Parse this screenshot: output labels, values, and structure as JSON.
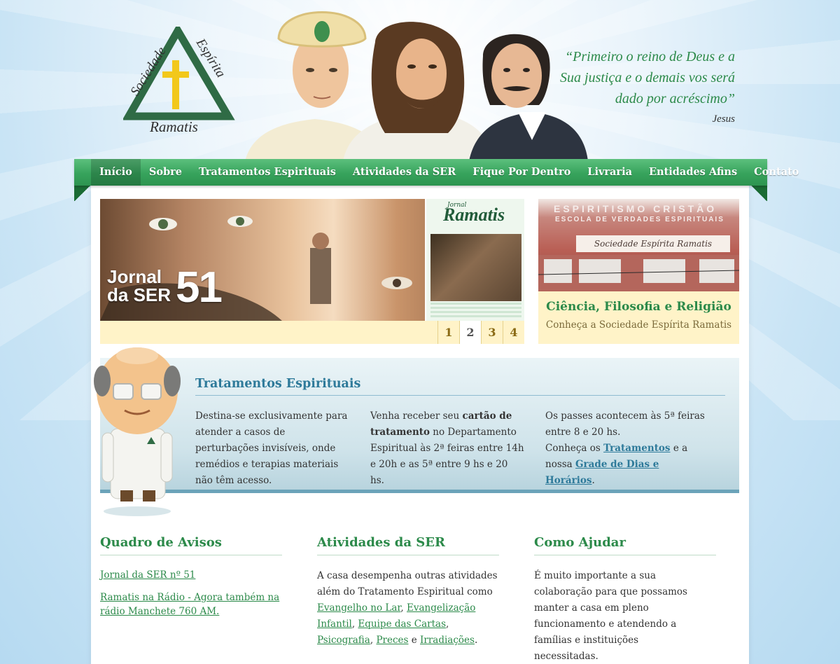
{
  "logo": {
    "line1": "Sociedade",
    "line2": "Espírita",
    "line3": "Ramatis",
    "colors": {
      "triangle": "#2f6b45",
      "cross": "#f2c81a"
    }
  },
  "quote": {
    "text": "“Primeiro o reino de Deus e a Sua justiça e o demais vos será dado por acréscimo”",
    "author": "Jesus"
  },
  "nav": {
    "items": [
      {
        "label": "Início",
        "active": true
      },
      {
        "label": "Sobre"
      },
      {
        "label": "Tratamentos Espirituais"
      },
      {
        "label": "Atividades da SER"
      },
      {
        "label": "Fique Por Dentro"
      },
      {
        "label": "Livraria"
      },
      {
        "label": "Entidades Afins"
      },
      {
        "label": "Contato"
      }
    ]
  },
  "slider": {
    "title": "Jornal\nda SER",
    "number": "51",
    "journal_pre": "Jornal",
    "journal_name": "Ramatis",
    "pages": [
      "1",
      "2",
      "3",
      "4"
    ],
    "active_page": "2"
  },
  "feature": {
    "sign_line1": "ESPIRITISMO CRISTÃO",
    "sign_line2": "ESCOLA DE VERDADES ESPIRITUAIS",
    "plate": "Sociedade Espírita Ramatis",
    "title": "Ciência, Filosofia e Religião",
    "subtitle": "Conheça a Sociedade Espírita Ramatis"
  },
  "treatments": {
    "title": "Tratamentos Espirituais",
    "col1": "Destina-se exclusivamente para atender a casos de perturbações invisíveis, onde remédios e terapias materiais não têm acesso.",
    "col2_pre": "Venha receber seu ",
    "col2_bold": "cartão de tratamento",
    "col2_post": " no Departamento Espiritual às 2ª feiras entre 14h e 20h e as 5ª entre 9 hs e 20 hs.",
    "col3_line1": "Os passes acontecem às 5ª feiras entre 8 e 20 hs.",
    "col3_pre": "Conheça os ",
    "col3_link1": "Tratamentos",
    "col3_mid": " e a nossa ",
    "col3_link2": "Grade de Dias e Horários",
    "col3_end": "."
  },
  "avisos": {
    "title": "Quadro de Avisos",
    "links": [
      "Jornal da SER nº 51",
      "Ramatis na Rádio - Agora também na rádio Manchete 760 AM."
    ]
  },
  "atividades": {
    "title": "Atividades da SER",
    "intro": "A casa desempenha outras atividades além do Tratamento Espiritual como ",
    "links": [
      "Evangelho no Lar",
      "Evangelização Infantil",
      "Equipe das Cartas",
      "Psicografia",
      "Preces",
      "Irradiações"
    ],
    "sep1": ", ",
    "sep2": ", ",
    "sep3": ", ",
    "sep4": " e ",
    "end": "."
  },
  "ajudar": {
    "title": "Como Ajudar",
    "text": "É muito importante a sua colaboração para que possamos manter a casa em pleno funcionamento e atendendo a famílias e instituições necessitadas."
  }
}
